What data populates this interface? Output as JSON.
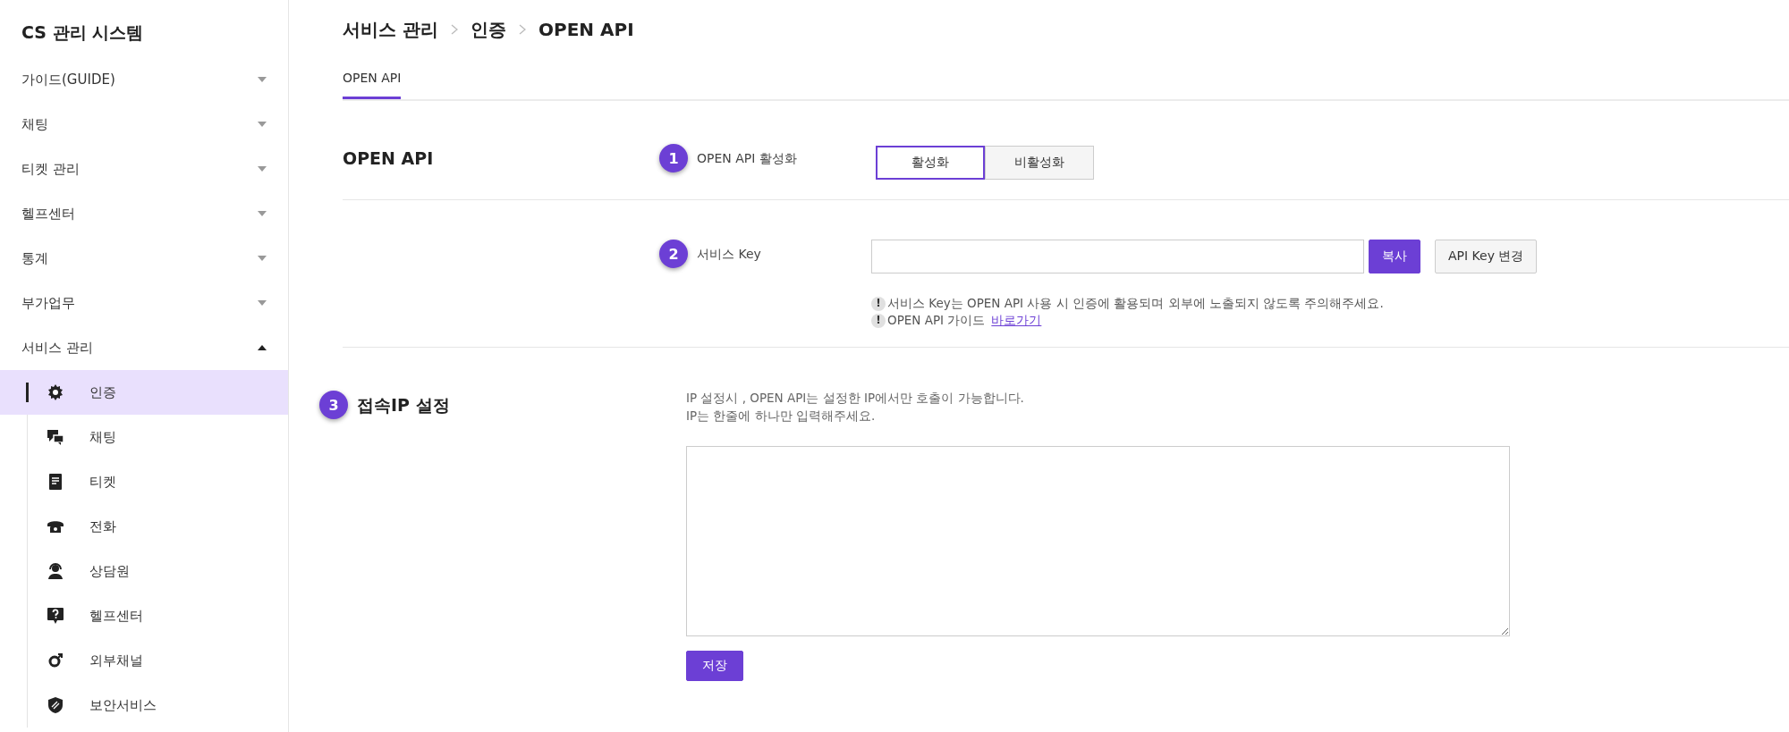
{
  "sidebar": {
    "title": "CS 관리 시스템",
    "menu": [
      {
        "label": "가이드(GUIDE)",
        "expanded": false
      },
      {
        "label": "채팅",
        "expanded": false
      },
      {
        "label": "티켓 관리",
        "expanded": false
      },
      {
        "label": "헬프센터",
        "expanded": false
      },
      {
        "label": "통계",
        "expanded": false
      },
      {
        "label": "부가업무",
        "expanded": false
      },
      {
        "label": "서비스 관리",
        "expanded": true,
        "children": [
          {
            "label": "인증",
            "selected": true
          },
          {
            "label": "채팅",
            "selected": false
          },
          {
            "label": "티켓",
            "selected": false
          },
          {
            "label": "전화",
            "selected": false
          },
          {
            "label": "상담원",
            "selected": false
          },
          {
            "label": "헬프센터",
            "selected": false
          },
          {
            "label": "외부채널",
            "selected": false
          },
          {
            "label": "보안서비스",
            "selected": false
          }
        ]
      }
    ]
  },
  "breadcrumb": [
    "서비스 관리",
    "인증",
    "OPEN API"
  ],
  "tabs": [
    {
      "label": "OPEN API",
      "selected": true
    }
  ],
  "sections": [
    {
      "title": "OPEN API",
      "rows": [
        {
          "kind": "toggle",
          "badge": "1",
          "label": "OPEN API 활성화",
          "options": [
            {
              "label": "활성화",
              "selected": true
            },
            {
              "label": "비활성화",
              "selected": false
            }
          ]
        },
        {
          "kind": "key",
          "badge": "2",
          "label": "서비스 Key",
          "value": "",
          "buttons": [
            {
              "label": "복사",
              "primary": true
            },
            {
              "label": "API Key 변경",
              "primary": false
            }
          ],
          "notes": [
            {
              "mark": "!",
              "text": "서비스 Key는 OPEN API 사용 시 인증에 활용되며 외부에 노출되지 않도록 주의해주세요."
            },
            {
              "mark": "!",
              "text": "OPEN API 가이드",
              "link": "바로가기"
            }
          ]
        }
      ]
    },
    {
      "title": "접속IP 설정",
      "badge": "3",
      "rows": [
        {
          "kind": "ip",
          "description": [
            "IP 설정시 , OPEN API는 설정한 IP에서만 호출이 가능합니다.",
            "IP는 한줄에 하나만 입력해주세요."
          ],
          "value": "",
          "button": "저장"
        }
      ]
    }
  ]
}
